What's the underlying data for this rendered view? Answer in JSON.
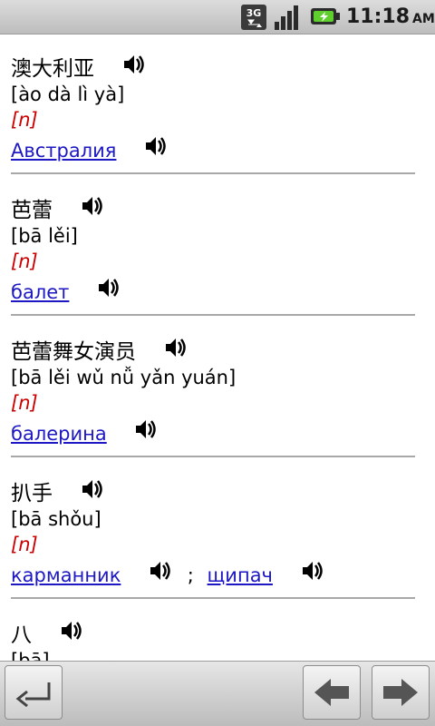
{
  "status_bar": {
    "network_label": "3G",
    "time": "11:18",
    "ampm": "AM",
    "icons": [
      "3g-data-icon",
      "signal-strength-icon",
      "battery-charging-icon"
    ]
  },
  "entries": [
    {
      "word": "澳大利亚",
      "pinyin": "[ào dà lì yà]",
      "pos": "[n]",
      "translations": [
        "Австралия"
      ]
    },
    {
      "word": "芭蕾",
      "pinyin": "[bā lěi]",
      "pos": "[n]",
      "translations": [
        "балет"
      ]
    },
    {
      "word": "芭蕾舞女演员",
      "pinyin": "[bā lěi wǔ nǚ yǎn yuán]",
      "pos": "[n]",
      "translations": [
        "балерина"
      ]
    },
    {
      "word": "扒手",
      "pinyin": "[bā shǒu]",
      "pos": "[n]",
      "translations": [
        "карманник",
        "щипач"
      ],
      "separator": ";"
    },
    {
      "word": "八",
      "pinyin": "[bā]"
    }
  ],
  "bottom_bar": {
    "back_icon": "return-arrow-icon",
    "prev_icon": "arrow-left-icon",
    "next_icon": "arrow-right-icon"
  },
  "colors": {
    "link": "#1d18c4",
    "pos": "#cc0000",
    "divider": "#a8a8a8"
  }
}
